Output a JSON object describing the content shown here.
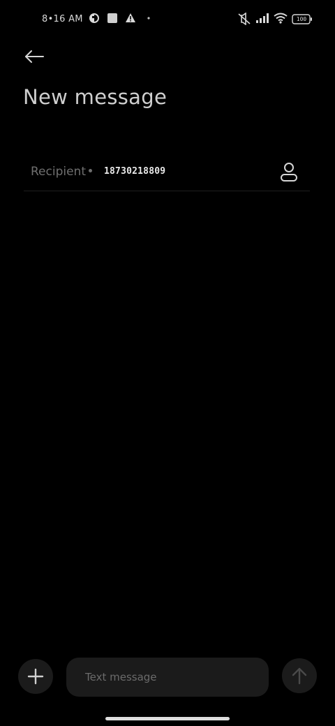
{
  "status_bar": {
    "time": "8•16 AM",
    "battery": "100"
  },
  "header": {
    "back_icon": "arrow-left-icon",
    "title": "New message"
  },
  "recipient": {
    "label": "Recipient",
    "value": "18730218809",
    "contact_icon": "person-icon"
  },
  "composer": {
    "placeholder": "Text message",
    "value": "",
    "add_icon": "plus-icon",
    "send_icon": "arrow-up-icon"
  },
  "colors": {
    "background": "#000000",
    "surface": "#1b1b1b",
    "text_primary": "#cfcfcf",
    "text_muted": "#6f6f6f"
  }
}
